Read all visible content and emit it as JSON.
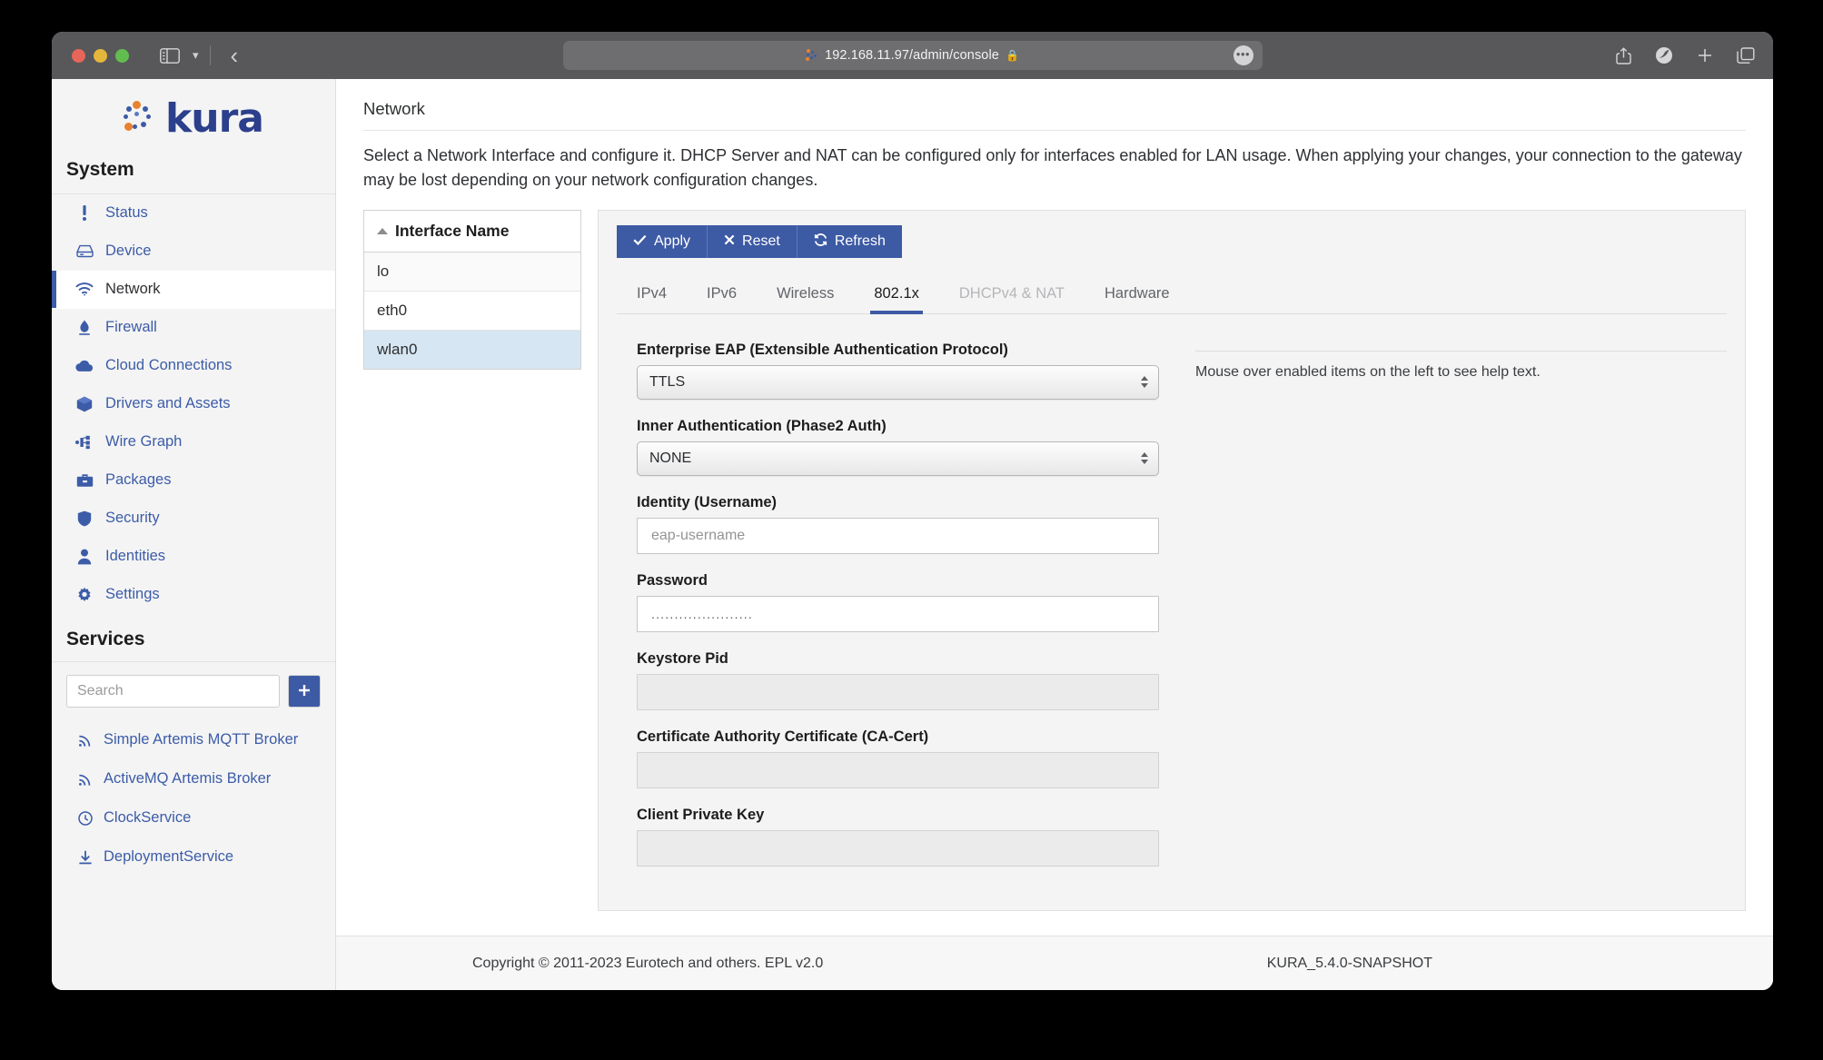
{
  "browser": {
    "url": "192.168.11.97/admin/console",
    "lock_icon": "lock-icon",
    "favicon": "kura-favicon",
    "sidebar_toggle_icon": "sidebar-toggle-icon",
    "chevron_icon": "chevron-down-icon",
    "back_icon": "back-arrow-icon",
    "ellipsis_icon": "ellipsis-icon",
    "share_icon": "share-icon",
    "extension_icon": "extension-shield-icon",
    "new_tab_icon": "plus-icon",
    "tabs_icon": "tab-overview-icon"
  },
  "sidebar": {
    "logo_text": "kura",
    "system_heading": "System",
    "services_heading": "Services",
    "nav_items": [
      {
        "label": "Status",
        "icon": "exclamation-icon",
        "active": false
      },
      {
        "label": "Device",
        "icon": "device-icon",
        "active": false
      },
      {
        "label": "Network",
        "icon": "wifi-icon",
        "active": true
      },
      {
        "label": "Firewall",
        "icon": "flame-icon",
        "active": false
      },
      {
        "label": "Cloud Connections",
        "icon": "cloud-icon",
        "active": false
      },
      {
        "label": "Drivers and Assets",
        "icon": "cube-icon",
        "active": false
      },
      {
        "label": "Wire Graph",
        "icon": "wire-graph-icon",
        "active": false
      },
      {
        "label": "Packages",
        "icon": "briefcase-icon",
        "active": false
      },
      {
        "label": "Security",
        "icon": "shield-icon",
        "active": false
      },
      {
        "label": "Identities",
        "icon": "user-icon",
        "active": false
      },
      {
        "label": "Settings",
        "icon": "gear-icon",
        "active": false
      }
    ],
    "search_placeholder": "Search",
    "add_button_label": "+",
    "services": [
      {
        "label": "Simple Artemis MQTT Broker",
        "icon": "broadcast-icon"
      },
      {
        "label": "ActiveMQ Artemis Broker",
        "icon": "broadcast-icon"
      },
      {
        "label": "ClockService",
        "icon": "clock-icon"
      },
      {
        "label": "DeploymentService",
        "icon": "download-icon"
      }
    ]
  },
  "main": {
    "title": "Network",
    "description": "Select a Network Interface and configure it. DHCP Server and NAT can be configured only for interfaces enabled for LAN usage. When applying your changes, your connection to the gateway may be lost depending on your network configuration changes.",
    "interface_table": {
      "column_header": "Interface Name",
      "sort_icon": "sort-ascending-icon",
      "rows": [
        {
          "name": "lo",
          "selected": false
        },
        {
          "name": "eth0",
          "selected": false
        },
        {
          "name": "wlan0",
          "selected": true
        }
      ]
    },
    "buttons": [
      {
        "label": "Apply",
        "icon": "check-icon"
      },
      {
        "label": "Reset",
        "icon": "x-icon"
      },
      {
        "label": "Refresh",
        "icon": "refresh-icon"
      }
    ],
    "tabs": [
      {
        "label": "IPv4",
        "active": false,
        "disabled": false
      },
      {
        "label": "IPv6",
        "active": false,
        "disabled": false
      },
      {
        "label": "Wireless",
        "active": false,
        "disabled": false
      },
      {
        "label": "802.1x",
        "active": true,
        "disabled": false
      },
      {
        "label": "DHCPv4 & NAT",
        "active": false,
        "disabled": true
      },
      {
        "label": "Hardware",
        "active": false,
        "disabled": false
      }
    ],
    "fields": {
      "eap": {
        "label": "Enterprise EAP (Extensible Authentication Protocol)",
        "value": "TTLS"
      },
      "inner_auth": {
        "label": "Inner Authentication (Phase2 Auth)",
        "value": "NONE"
      },
      "identity": {
        "label": "Identity (Username)",
        "value": "",
        "placeholder": "eap-username"
      },
      "password": {
        "label": "Password",
        "value": "......................"
      },
      "keystore_pid": {
        "label": "Keystore Pid",
        "value": "",
        "disabled": true
      },
      "ca_cert": {
        "label": "Certificate Authority Certificate (CA-Cert)",
        "value": "",
        "disabled": true
      },
      "client_key": {
        "label": "Client Private Key",
        "value": "",
        "disabled": true
      }
    },
    "help_text": "Mouse over enabled items on the left to see help text."
  },
  "footer": {
    "copyright": "Copyright © 2011-2023 Eurotech and others. EPL v2.0",
    "version": "KURA_5.4.0-SNAPSHOT"
  },
  "colors": {
    "accent": "#3d5aa4",
    "link": "#3c5ca8",
    "selected_row": "#d6e6f2",
    "logo": "#2b3f8c"
  }
}
